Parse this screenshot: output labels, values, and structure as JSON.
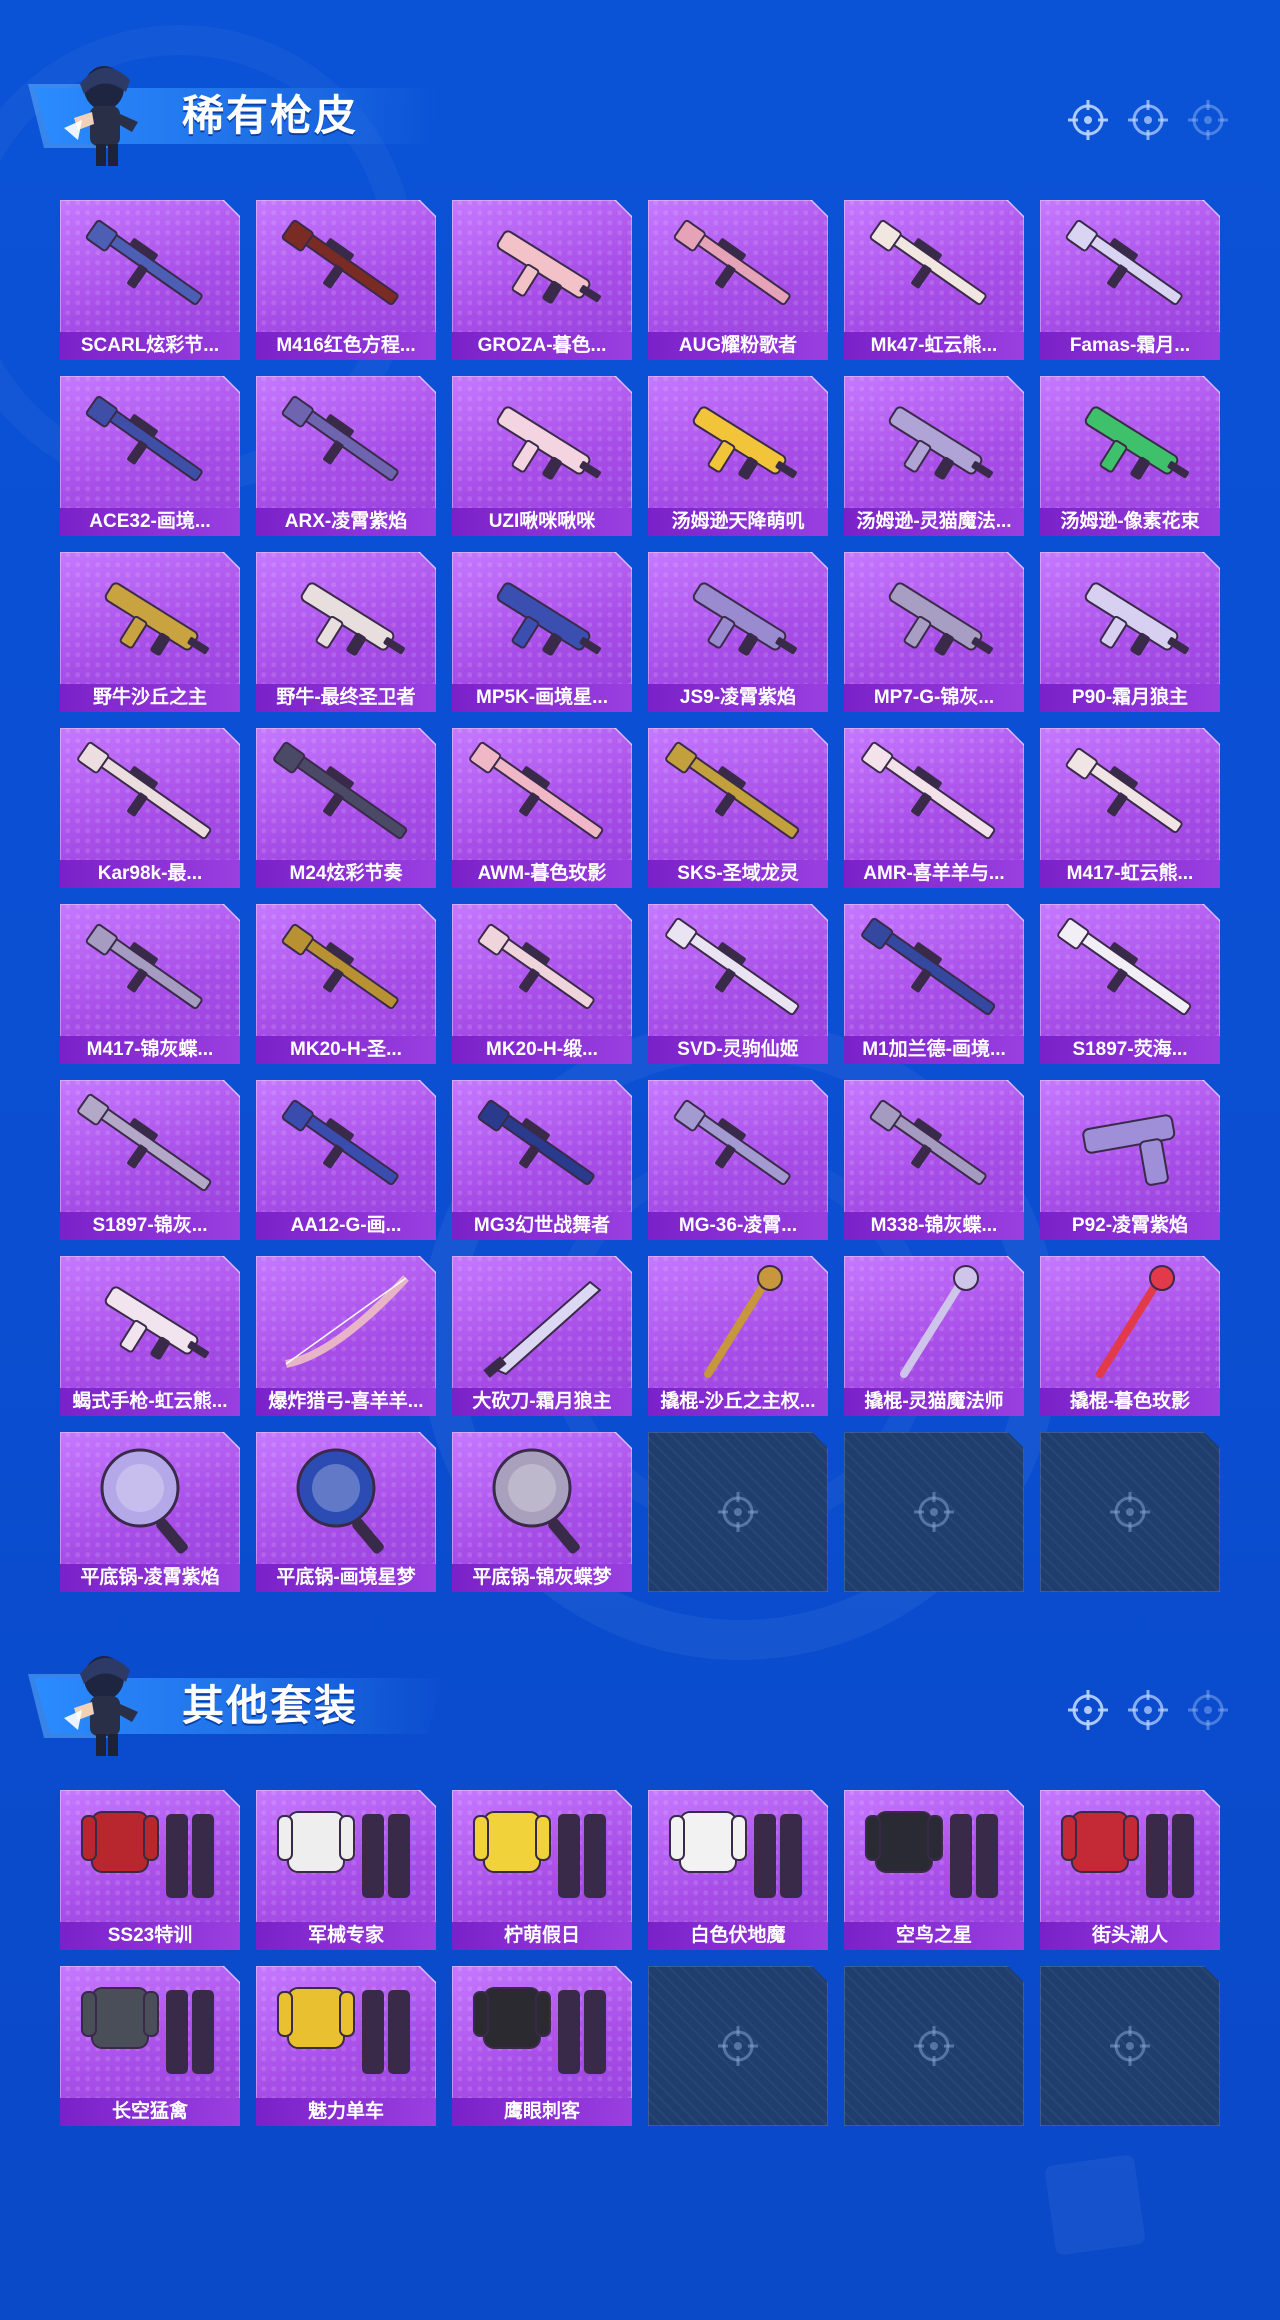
{
  "sections": [
    {
      "title": "稀有枪皮",
      "items": [
        {
          "label": "SCARL炫彩节...",
          "kind": "rifle",
          "hue": "#4c5fb5"
        },
        {
          "label": "M416红色方程...",
          "kind": "rifle",
          "hue": "#7a2b24"
        },
        {
          "label": "GROZA-暮色...",
          "kind": "smg",
          "hue": "#f2c2c8"
        },
        {
          "label": "AUG耀粉歌者",
          "kind": "rifle",
          "hue": "#e6a3b8"
        },
        {
          "label": "Mk47-虹云熊...",
          "kind": "rifle",
          "hue": "#f1e6e0"
        },
        {
          "label": "Famas-霜月...",
          "kind": "rifle",
          "hue": "#d9d4f2"
        },
        {
          "label": "ACE32-画境...",
          "kind": "rifle",
          "hue": "#3f4fa8"
        },
        {
          "label": "ARX-凌霄紫焰",
          "kind": "rifle",
          "hue": "#6e64b0"
        },
        {
          "label": "UZI啾咪啾咪",
          "kind": "smg",
          "hue": "#f4d4e0"
        },
        {
          "label": "汤姆逊天降萌叽",
          "kind": "smg",
          "hue": "#f2c43a"
        },
        {
          "label": "汤姆逊-灵猫魔法...",
          "kind": "smg",
          "hue": "#b0a4d6"
        },
        {
          "label": "汤姆逊-像素花束",
          "kind": "smg",
          "hue": "#3fc06a"
        },
        {
          "label": "野牛沙丘之主",
          "kind": "smg",
          "hue": "#c9a33f"
        },
        {
          "label": "野牛-最终圣卫者",
          "kind": "smg",
          "hue": "#e8dede"
        },
        {
          "label": "MP5K-画境星...",
          "kind": "smg",
          "hue": "#3a4fb0"
        },
        {
          "label": "JS9-凌霄紫焰",
          "kind": "smg",
          "hue": "#9a8ad0"
        },
        {
          "label": "MP7-G-锦灰...",
          "kind": "smg",
          "hue": "#a89ec4"
        },
        {
          "label": "P90-霜月狼主",
          "kind": "smg",
          "hue": "#d8d0f0"
        },
        {
          "label": "Kar98k-最...",
          "kind": "sniper",
          "hue": "#ecdede"
        },
        {
          "label": "M24炫彩节奏",
          "kind": "sniper",
          "hue": "#4a4a66"
        },
        {
          "label": "AWM-暮色玫影",
          "kind": "sniper",
          "hue": "#f0b8c6"
        },
        {
          "label": "SKS-圣域龙灵",
          "kind": "sniper",
          "hue": "#c2a03c"
        },
        {
          "label": "AMR-喜羊羊与...",
          "kind": "sniper",
          "hue": "#f4e2ea"
        },
        {
          "label": "M417-虹云熊...",
          "kind": "rifle",
          "hue": "#f0e4e4"
        },
        {
          "label": "M417-锦灰蝶...",
          "kind": "rifle",
          "hue": "#a69cc2"
        },
        {
          "label": "MK20-H-圣...",
          "kind": "rifle",
          "hue": "#b89232"
        },
        {
          "label": "MK20-H-缎...",
          "kind": "rifle",
          "hue": "#f0d4dc"
        },
        {
          "label": "SVD-灵驹仙姬",
          "kind": "sniper",
          "hue": "#eae4f2"
        },
        {
          "label": "M1加兰德-画境...",
          "kind": "sniper",
          "hue": "#3448a0"
        },
        {
          "label": "S1897-荧海...",
          "kind": "sniper",
          "hue": "#f2eef6"
        },
        {
          "label": "S1897-锦灰...",
          "kind": "sniper",
          "hue": "#b4a8c8"
        },
        {
          "label": "AA12-G-画...",
          "kind": "rifle",
          "hue": "#3a4cae"
        },
        {
          "label": "MG3幻世战舞者",
          "kind": "rifle",
          "hue": "#2a3a8c"
        },
        {
          "label": "MG-36-凌霄...",
          "kind": "rifle",
          "hue": "#a49ad2"
        },
        {
          "label": "M338-锦灰蝶...",
          "kind": "rifle",
          "hue": "#a59bc0"
        },
        {
          "label": "P92-凌霄紫焰",
          "kind": "pistol",
          "hue": "#9f8fd8"
        },
        {
          "label": "蝎式手枪-虹云熊...",
          "kind": "smg",
          "hue": "#f2e4ee"
        },
        {
          "label": "爆炸猎弓-喜羊羊...",
          "kind": "bow",
          "hue": "#e8b4c8"
        },
        {
          "label": "大砍刀-霜月狼主",
          "kind": "blade",
          "hue": "#dcd8f4"
        },
        {
          "label": "撬棍-沙丘之主权...",
          "kind": "staff",
          "hue": "#c8963c"
        },
        {
          "label": "撬棍-灵猫魔法师",
          "kind": "staff",
          "hue": "#cfc4ea"
        },
        {
          "label": "撬棍-暮色玫影",
          "kind": "staff",
          "hue": "#e23a4a"
        },
        {
          "label": "平底锅-凌霄紫焰",
          "kind": "pan",
          "hue": "#b4a8e8"
        },
        {
          "label": "平底锅-画境星梦",
          "kind": "pan",
          "hue": "#2c4cb4"
        },
        {
          "label": "平底锅-锦灰蝶梦",
          "kind": "pan",
          "hue": "#a8a0bc"
        }
      ],
      "empty_slots": 3
    },
    {
      "title": "其他套装",
      "items": [
        {
          "label": "SS23特训",
          "kind": "outfit",
          "hue": "#b8262e"
        },
        {
          "label": "军械专家",
          "kind": "outfit",
          "hue": "#eeeeee"
        },
        {
          "label": "柠萌假日",
          "kind": "outfit",
          "hue": "#f2d23a"
        },
        {
          "label": "白色伏地魔",
          "kind": "outfit",
          "hue": "#f2f2f2"
        },
        {
          "label": "空鸟之星",
          "kind": "outfit",
          "hue": "#2a2a34"
        },
        {
          "label": "街头潮人",
          "kind": "outfit",
          "hue": "#c42a36"
        },
        {
          "label": "长空猛禽",
          "kind": "outfit",
          "hue": "#4a4e58"
        },
        {
          "label": "魅力单车",
          "kind": "outfit",
          "hue": "#e8c030"
        },
        {
          "label": "鹰眼刺客",
          "kind": "outfit",
          "hue": "#2a2a30"
        }
      ],
      "empty_slots": 3
    }
  ],
  "icons": {
    "crosshair": "crosshair-icon",
    "empty_slot": "crosshair-icon"
  },
  "colors": {
    "background": "#0a52d6",
    "card": "#a84ee8",
    "label_bar": "#7a21c9",
    "empty_card": "#1f3e6e"
  }
}
